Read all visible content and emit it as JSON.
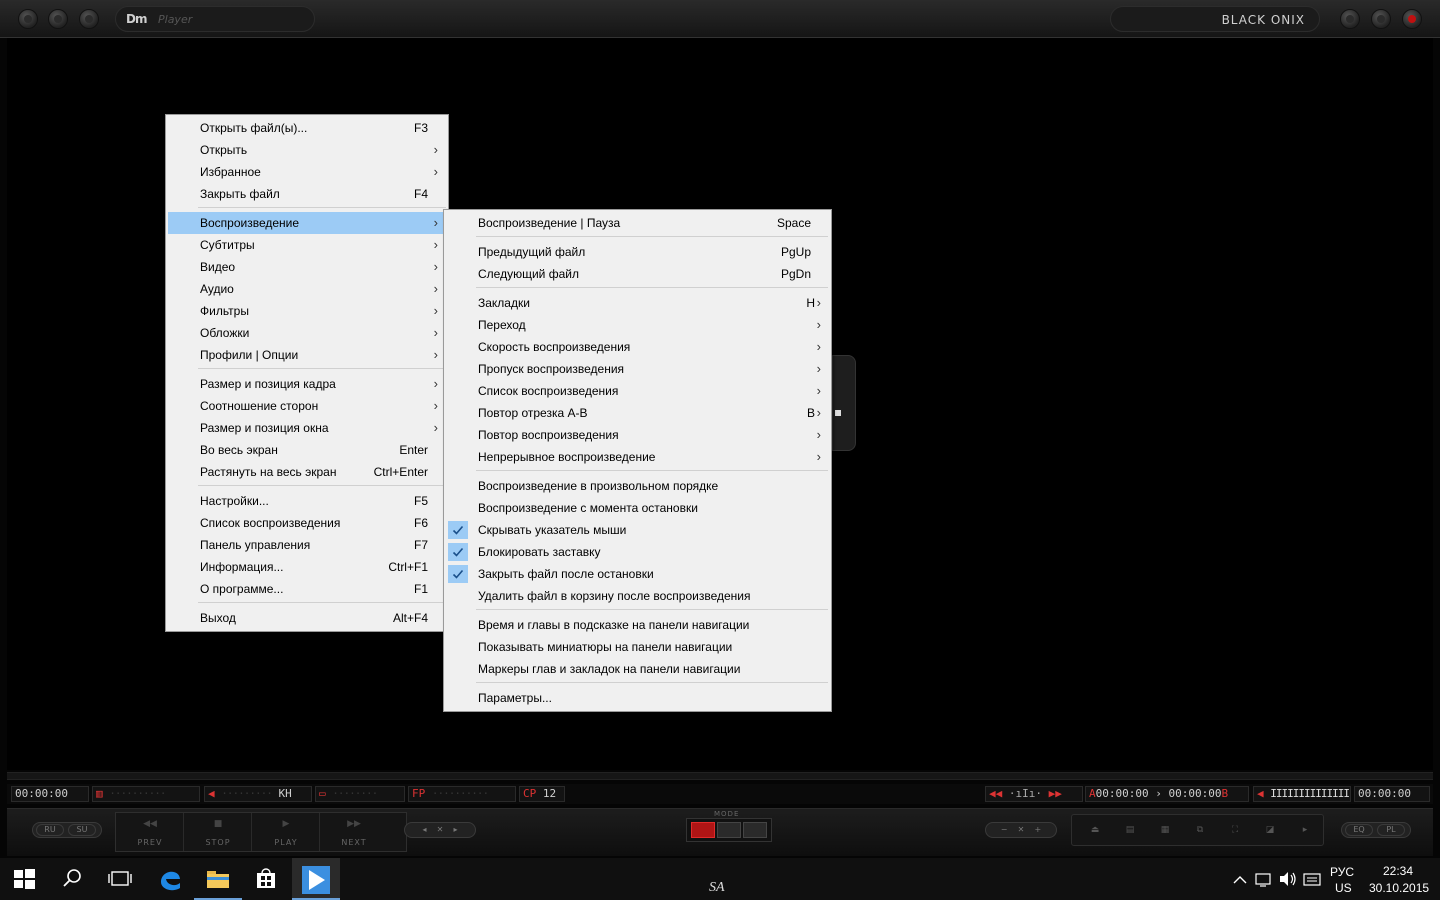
{
  "titlebar": {
    "logo_mark": "Dm",
    "logo_sub": "Player",
    "skin_name": "BLACK  ONIX"
  },
  "main_menu": {
    "items": [
      {
        "label": "Открыть файл(ы)...",
        "shortcut": "F3",
        "submenu": false
      },
      {
        "label": "Открыть",
        "shortcut": "",
        "submenu": true
      },
      {
        "label": "Избранное",
        "shortcut": "",
        "submenu": true
      },
      {
        "label": "Закрыть файл",
        "shortcut": "F4",
        "submenu": false
      },
      {
        "label": "Воспроизведение",
        "shortcut": "",
        "submenu": true,
        "highlighted": true
      },
      {
        "label": "Субтитры",
        "shortcut": "",
        "submenu": true
      },
      {
        "label": "Видео",
        "shortcut": "",
        "submenu": true
      },
      {
        "label": "Аудио",
        "shortcut": "",
        "submenu": true
      },
      {
        "label": "Фильтры",
        "shortcut": "",
        "submenu": true
      },
      {
        "label": "Обложки",
        "shortcut": "",
        "submenu": true
      },
      {
        "label": "Профили | Опции",
        "shortcut": "",
        "submenu": true
      },
      {
        "label": "Размер и позиция кадра",
        "shortcut": "",
        "submenu": true
      },
      {
        "label": "Соотношение сторон",
        "shortcut": "",
        "submenu": true
      },
      {
        "label": "Размер и позиция окна",
        "shortcut": "",
        "submenu": true
      },
      {
        "label": "Во весь экран",
        "shortcut": "Enter",
        "submenu": false
      },
      {
        "label": "Растянуть на весь экран",
        "shortcut": "Ctrl+Enter",
        "submenu": false
      },
      {
        "label": "Настройки...",
        "shortcut": "F5",
        "submenu": false
      },
      {
        "label": "Список воспроизведения",
        "shortcut": "F6",
        "submenu": false
      },
      {
        "label": "Панель управления",
        "shortcut": "F7",
        "submenu": false
      },
      {
        "label": "Информация...",
        "shortcut": "Ctrl+F1",
        "submenu": false
      },
      {
        "label": "О программе...",
        "shortcut": "F1",
        "submenu": false
      },
      {
        "label": "Выход",
        "shortcut": "Alt+F4",
        "submenu": false
      }
    ]
  },
  "playback_submenu": {
    "items": [
      {
        "label": "Воспроизведение | Пауза",
        "shortcut": "Space",
        "submenu": false,
        "checked": false
      },
      {
        "label": "Предыдущий файл",
        "shortcut": "PgUp",
        "submenu": false,
        "checked": false
      },
      {
        "label": "Следующий файл",
        "shortcut": "PgDn",
        "submenu": false,
        "checked": false
      },
      {
        "label": "Закладки",
        "shortcut": "H",
        "submenu": true,
        "checked": false
      },
      {
        "label": "Переход",
        "shortcut": "",
        "submenu": true,
        "checked": false
      },
      {
        "label": "Скорость воспроизведения",
        "shortcut": "",
        "submenu": true,
        "checked": false
      },
      {
        "label": "Пропуск воспроизведения",
        "shortcut": "",
        "submenu": true,
        "checked": false
      },
      {
        "label": "Список воспроизведения",
        "shortcut": "",
        "submenu": true,
        "checked": false
      },
      {
        "label": "Повтор отрезка A-B",
        "shortcut": "B",
        "submenu": true,
        "checked": false
      },
      {
        "label": "Повтор воспроизведения",
        "shortcut": "",
        "submenu": true,
        "checked": false
      },
      {
        "label": "Непрерывное воспроизведение",
        "shortcut": "",
        "submenu": true,
        "checked": false
      },
      {
        "label": "Воспроизведение в произвольном порядке",
        "shortcut": "",
        "submenu": false,
        "checked": false
      },
      {
        "label": "Воспроизведение с момента остановки",
        "shortcut": "",
        "submenu": false,
        "checked": false
      },
      {
        "label": "Скрывать указатель мыши",
        "shortcut": "",
        "submenu": false,
        "checked": true
      },
      {
        "label": "Блокировать заставку",
        "shortcut": "",
        "submenu": false,
        "checked": true
      },
      {
        "label": "Закрыть файл после остановки",
        "shortcut": "",
        "submenu": false,
        "checked": true
      },
      {
        "label": "Удалить файл в корзину после воспроизведения",
        "shortcut": "",
        "submenu": false,
        "checked": false
      },
      {
        "label": "Время и главы в подсказке на панели навигации",
        "shortcut": "",
        "submenu": false,
        "checked": false
      },
      {
        "label": "Показывать миниатюры на панели навигации",
        "shortcut": "",
        "submenu": false,
        "checked": false
      },
      {
        "label": "Маркеры глав и закладок на панели навигации",
        "shortcut": "",
        "submenu": false,
        "checked": false
      },
      {
        "label": "Параметры...",
        "shortcut": "",
        "submenu": false,
        "checked": false
      }
    ]
  },
  "info_strip": {
    "time_elapsed": "00:00:00",
    "kh": "KH",
    "fp": "FP",
    "cp": "CP",
    "cp_value": "12",
    "ab_time": "00:00:00 › 00:00:00",
    "a_label": "A",
    "b_label": "B",
    "time_total": "00:00:00"
  },
  "controls": {
    "ru": "RU",
    "su": "SU",
    "prev": "PREV",
    "stop": "STOP",
    "play": "PLAY",
    "next": "NEXT",
    "mode": "MODE",
    "eq": "EQ",
    "pl": "PL"
  },
  "taskbar": {
    "lang_top": "РУС",
    "lang_bottom": "US",
    "time": "22:34",
    "date": "30.10.2015",
    "center_mark": "SA"
  },
  "colors": {
    "menu_bg": "#f0f0f0",
    "menu_highlight": "#9ccbf5",
    "lcd_red": "#d33333",
    "taskbar_accent": "#6aa0d8"
  }
}
